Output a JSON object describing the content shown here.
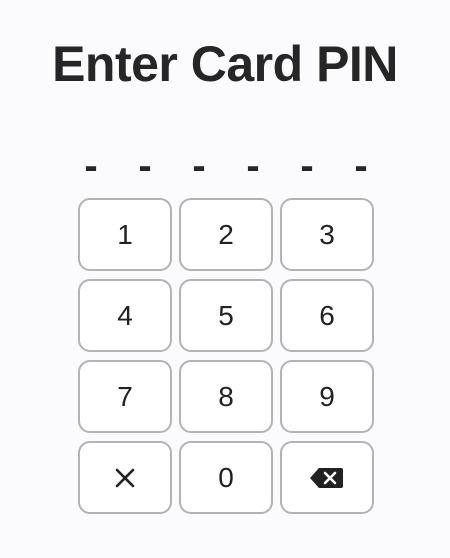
{
  "title": "Enter Card PIN",
  "pin": {
    "slots": [
      "-",
      "-",
      "-",
      "-",
      "-",
      "-"
    ]
  },
  "keypad": {
    "digits": [
      "1",
      "2",
      "3",
      "4",
      "5",
      "6",
      "7",
      "8",
      "9",
      "0"
    ],
    "clear_icon": "close-icon",
    "backspace_icon": "backspace-icon"
  },
  "colors": {
    "background": "#fbfbfd",
    "text": "#262626",
    "key_border": "#b3b3b3",
    "key_fill": "#ffffff"
  }
}
